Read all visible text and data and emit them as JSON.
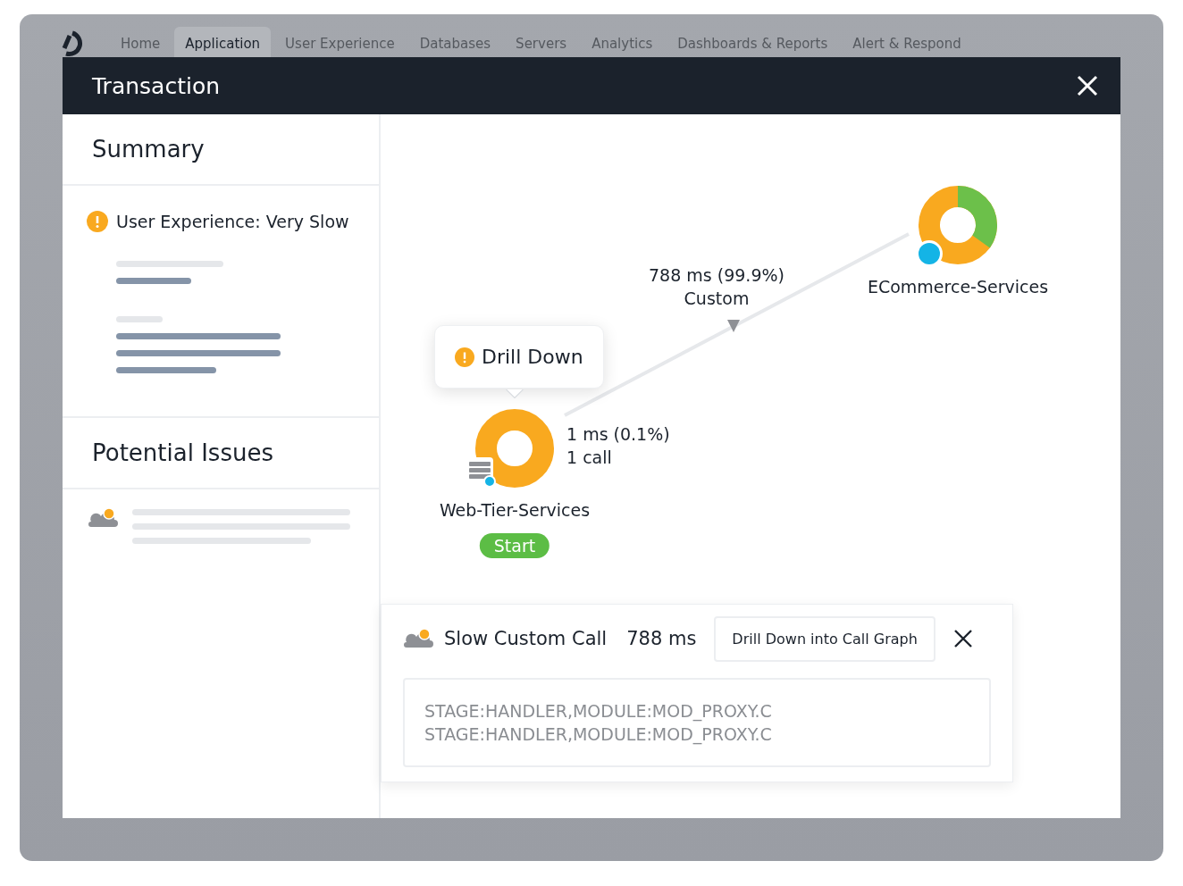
{
  "nav": {
    "tabs": [
      {
        "label": "Home",
        "selected": false
      },
      {
        "label": "Application",
        "selected": true
      },
      {
        "label": "User Experience",
        "selected": false
      },
      {
        "label": "Databases",
        "selected": false
      },
      {
        "label": "Servers",
        "selected": false
      },
      {
        "label": "Analytics",
        "selected": false
      },
      {
        "label": "Dashboards & Reports",
        "selected": false
      },
      {
        "label": "Alert & Respond",
        "selected": false
      }
    ]
  },
  "dialog": {
    "title": "Transaction"
  },
  "summary": {
    "title": "Summary",
    "alert": "User Experience: Very Slow"
  },
  "potential_issues": {
    "title": "Potential Issues"
  },
  "flow_map": {
    "nodes": [
      {
        "kind": "web",
        "name": "Web-Tier-Services",
        "badge": "Start",
        "stats": [
          "1 ms (0.1%)",
          "1 call"
        ],
        "tooltip": "Drill Down"
      },
      {
        "kind": "service",
        "name": "ECommerce-Services"
      }
    ],
    "edge": {
      "labels": [
        "788 ms (99.9%)",
        "Custom"
      ]
    }
  },
  "detail": {
    "title": "Slow Custom Call",
    "duration": "788 ms",
    "button": "Drill Down into Call Graph",
    "lines": [
      "STAGE:HANDLER,MODULE:MOD_PROXY.C",
      "STAGE:HANDLER,MODULE:MOD_PROXY.C"
    ]
  }
}
